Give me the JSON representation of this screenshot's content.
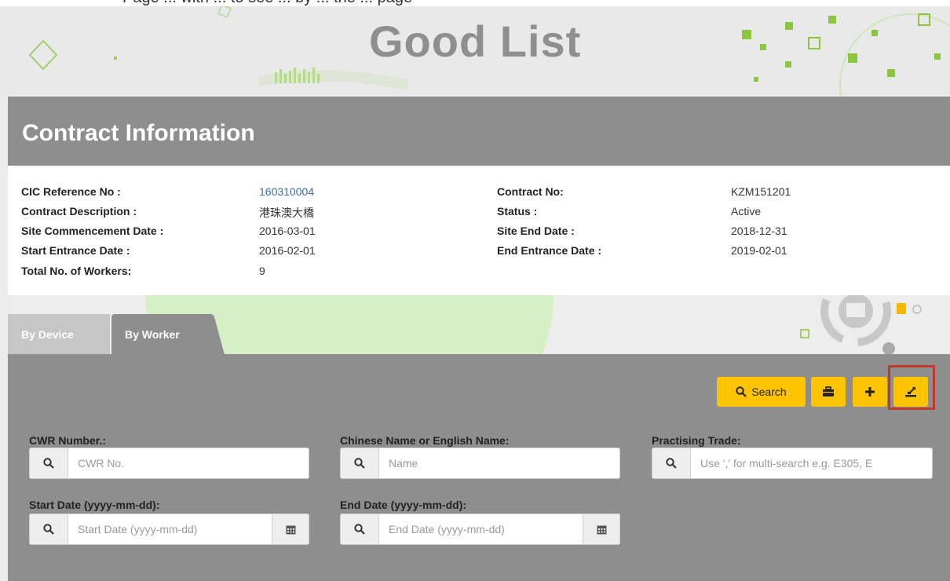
{
  "top_clipped_text": "Page ... with ... to see ... by ... the ... page",
  "header": {
    "title": "Good List"
  },
  "contract": {
    "title": "Contract Information",
    "left": [
      {
        "label": "CIC Reference No :",
        "value": "160310004"
      },
      {
        "label": "Contract Description :",
        "value": "港珠澳大橋"
      },
      {
        "label": "Site Commencement Date :",
        "value": "2016-03-01"
      },
      {
        "label": "Start Entrance Date :",
        "value": "2016-02-01"
      },
      {
        "label": "Total No. of Workers:",
        "value": "9"
      }
    ],
    "right": [
      {
        "label": "Contract No:",
        "value": "KZM151201"
      },
      {
        "label": "Status :",
        "value": "Active"
      },
      {
        "label": "Site End Date :",
        "value": "2018-12-31"
      },
      {
        "label": "End Entrance Date :",
        "value": "2019-02-01"
      }
    ]
  },
  "tabs": [
    {
      "label": "By Device",
      "active": false
    },
    {
      "label": "By Worker",
      "active": true
    }
  ],
  "toolbar": {
    "search_label": "Search",
    "accent_color": "#ffc400",
    "highlight_color": "#c0392b"
  },
  "filters": {
    "cwr": {
      "label": "CWR Number.:",
      "placeholder": "CWR No."
    },
    "name": {
      "label": "Chinese Name or English Name:",
      "placeholder": "Name"
    },
    "trade": {
      "label": "Practising Trade:",
      "placeholder": "Use ',' for multi-search e.g. E305, E"
    },
    "start_date": {
      "label": "Start Date (yyyy-mm-dd):",
      "placeholder": "Start Date (yyyy-mm-dd)"
    },
    "end_date": {
      "label": "End Date (yyyy-mm-dd):",
      "placeholder": "End Date (yyyy-mm-dd)"
    }
  }
}
